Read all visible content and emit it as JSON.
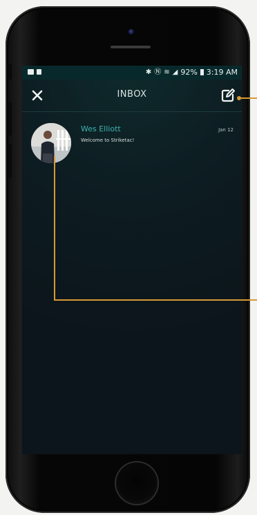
{
  "status_bar": {
    "battery": "92%",
    "time": "3:19 AM"
  },
  "header": {
    "title": "INBOX"
  },
  "messages": [
    {
      "sender": "Wes Elliott",
      "preview": "Welcome to Striketac!",
      "date": "Jan 12"
    }
  ],
  "colors": {
    "accent": "#3fb3b0",
    "callout": "#d89a35",
    "status_bar": "#08292b"
  }
}
